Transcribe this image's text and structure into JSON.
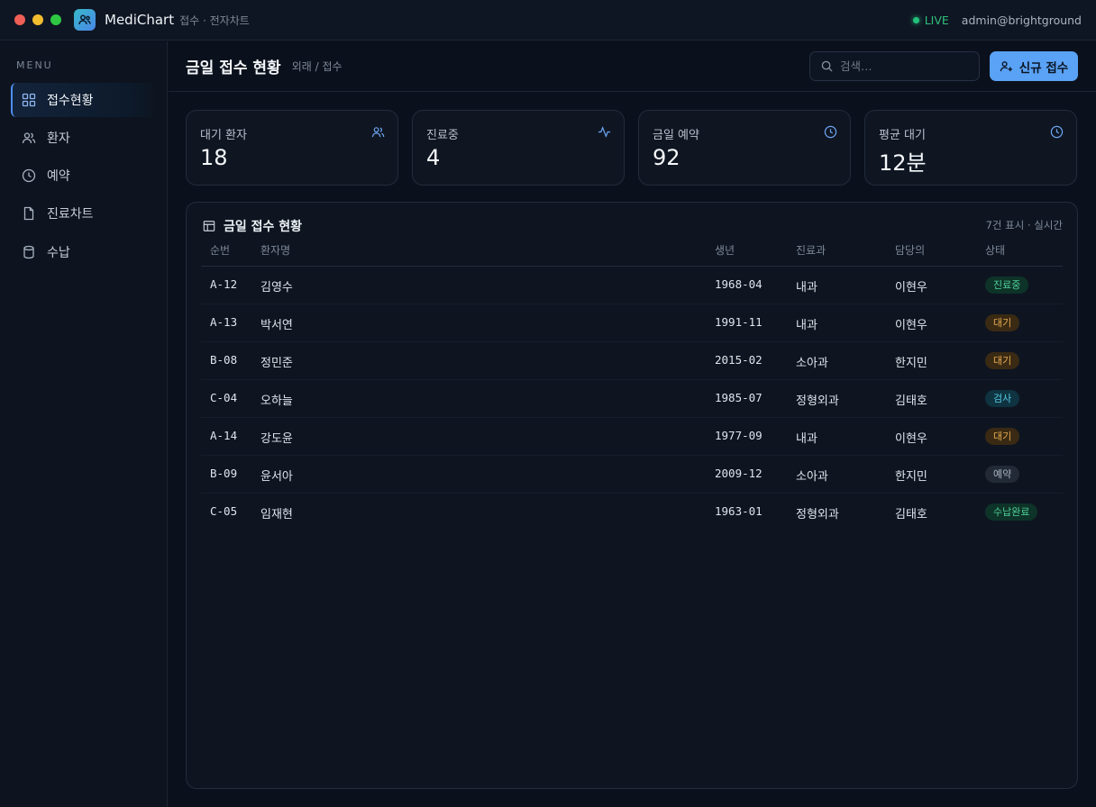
{
  "app": {
    "name": "MediChart",
    "subtitle": "접수 · 전자차트",
    "live_label": "LIVE",
    "user": "admin@brightground"
  },
  "sidebar": {
    "menu_label": "MENU",
    "items": [
      {
        "label": "접수현황",
        "icon": "grid-icon",
        "active": true
      },
      {
        "label": "환자",
        "icon": "users-icon",
        "active": false
      },
      {
        "label": "예약",
        "icon": "clock-icon",
        "active": false
      },
      {
        "label": "진료차트",
        "icon": "file-icon",
        "active": false
      },
      {
        "label": "수납",
        "icon": "database-icon",
        "active": false
      }
    ]
  },
  "header": {
    "title": "금일 접수 현황",
    "breadcrumb": "외래 / 접수",
    "search_placeholder": "검색…",
    "new_button": "신규 접수"
  },
  "stats": [
    {
      "label": "대기 환자",
      "value": "18",
      "icon": "users-icon"
    },
    {
      "label": "진료중",
      "value": "4",
      "icon": "activity-icon"
    },
    {
      "label": "금일 예약",
      "value": "92",
      "icon": "clock-icon"
    },
    {
      "label": "평균 대기",
      "value": "12분",
      "icon": "clock-icon"
    }
  ],
  "panel": {
    "title": "금일 접수 현황",
    "meta": "7건 표시 · 실시간",
    "columns": [
      "순번",
      "환자명",
      "생년",
      "진료과",
      "담당의",
      "상태"
    ],
    "rows": [
      {
        "no": "A-12",
        "name": "김영수",
        "birth": "1968-04",
        "dept": "내과",
        "doctor": "이현우",
        "status": "진료중",
        "status_type": "treat"
      },
      {
        "no": "A-13",
        "name": "박서연",
        "birth": "1991-11",
        "dept": "내과",
        "doctor": "이현우",
        "status": "대기",
        "status_type": "wait"
      },
      {
        "no": "B-08",
        "name": "정민준",
        "birth": "2015-02",
        "dept": "소아과",
        "doctor": "한지민",
        "status": "대기",
        "status_type": "wait"
      },
      {
        "no": "C-04",
        "name": "오하늘",
        "birth": "1985-07",
        "dept": "정형외과",
        "doctor": "김태호",
        "status": "검사",
        "status_type": "test"
      },
      {
        "no": "A-14",
        "name": "강도윤",
        "birth": "1977-09",
        "dept": "내과",
        "doctor": "이현우",
        "status": "대기",
        "status_type": "wait"
      },
      {
        "no": "B-09",
        "name": "윤서아",
        "birth": "2009-12",
        "dept": "소아과",
        "doctor": "한지민",
        "status": "예약",
        "status_type": "resv"
      },
      {
        "no": "C-05",
        "name": "임재현",
        "birth": "1963-01",
        "dept": "정형외과",
        "doctor": "김태호",
        "status": "수납완료",
        "status_type": "paid"
      }
    ]
  },
  "colors": {
    "accent": "#5aa2f5",
    "live": "#22c27a",
    "background": "#0b111c"
  }
}
